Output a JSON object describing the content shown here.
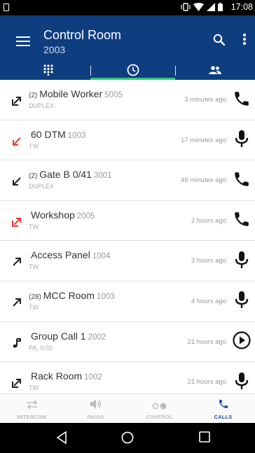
{
  "status_bar": {
    "time": "17:08"
  },
  "header": {
    "title": "Control Room",
    "subtitle": "2003",
    "tabs": [
      {
        "icon": "dialpad-icon"
      },
      {
        "icon": "clock-icon",
        "active": true
      },
      {
        "icon": "contacts-icon"
      }
    ]
  },
  "calls": [
    {
      "count": "(2)",
      "name": "Mobile Worker",
      "ext": "5005",
      "type": "DUPLEX",
      "ago": "3 minutes ago",
      "direction": "outgoing-ne",
      "missed": false,
      "action_icon": "phone-icon"
    },
    {
      "count": "",
      "name": "60 DTM",
      "ext": "1003",
      "type": "TW",
      "ago": "17 minutes ago",
      "direction": "incoming-sw",
      "missed": true,
      "action_icon": "microphone-icon"
    },
    {
      "count": "(2)",
      "name": "Gate B 0/41",
      "ext": "3001",
      "type": "DUPLEX",
      "ago": "48 minutes ago",
      "direction": "incoming-sw",
      "missed": false,
      "action_icon": "phone-icon"
    },
    {
      "count": "",
      "name": "Workshop",
      "ext": "2005",
      "type": "TW",
      "ago": "2 hours ago",
      "direction": "outgoing-ne",
      "missed": true,
      "action_icon": "phone-icon"
    },
    {
      "count": "",
      "name": "Access Panel",
      "ext": "1004",
      "type": "TW",
      "ago": "3 hours ago",
      "direction": "outgoing-ne-plain",
      "missed": false,
      "action_icon": "microphone-icon"
    },
    {
      "count": "(28)",
      "name": "MCC Room",
      "ext": "1003",
      "type": "TW",
      "ago": "4 hours ago",
      "direction": "outgoing-ne-plain",
      "missed": false,
      "action_icon": "microphone-icon"
    },
    {
      "count": "",
      "name": "Group Call 1",
      "ext": "2002",
      "type": "PA, 0:02",
      "ago": "21 hours ago",
      "direction": "music-note",
      "missed": false,
      "action_icon": "play-circle-icon"
    },
    {
      "count": "",
      "name": "Rack Room",
      "ext": "1002",
      "type": "TW",
      "ago": "21 hours ago",
      "direction": "outgoing-ne",
      "missed": false,
      "action_icon": "microphone-icon"
    }
  ],
  "bottom_nav": [
    {
      "label": "INTERCOM",
      "icon": "swap-arrows-icon",
      "active": false
    },
    {
      "label": "PA/GA",
      "icon": "speaker-icon",
      "active": false
    },
    {
      "label": "CONTROL",
      "icon": "toggle-icon",
      "active": false
    },
    {
      "label": "CALLS",
      "icon": "phone-icon",
      "active": true
    }
  ],
  "colors": {
    "appbar": "#0e3d80",
    "tab_indicator": "#2ecc71",
    "missed": "#e53935",
    "active_nav": "#1a4f9c"
  }
}
